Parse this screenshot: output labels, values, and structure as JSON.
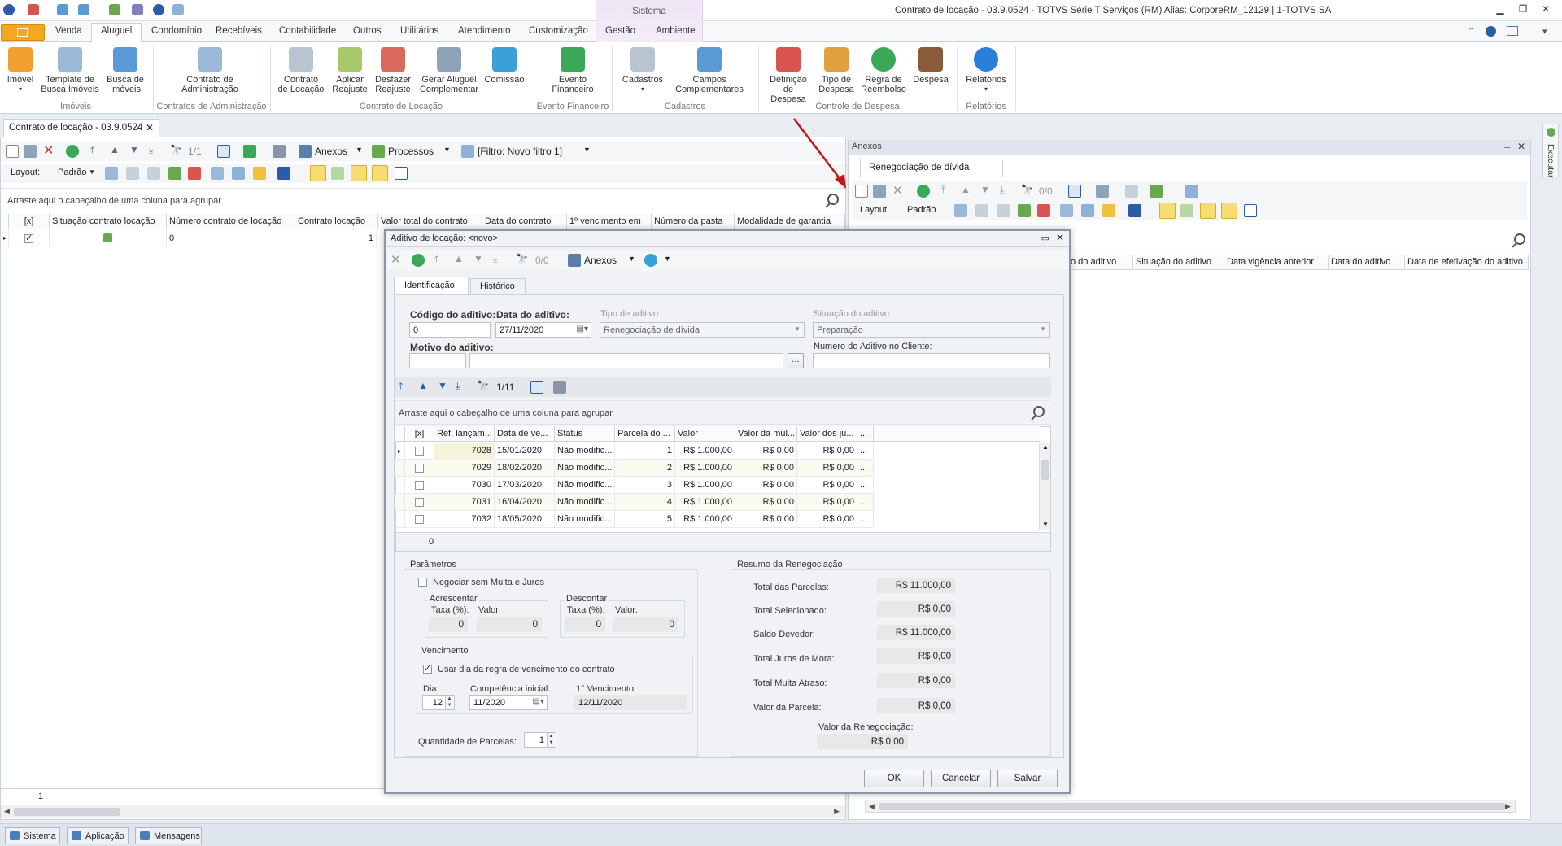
{
  "window": {
    "title": "Contrato de locação - 03.9.0524 - TOTVS Série T Serviços (RM) Alias: CorporeRM_12129 | 1-TOTVS SA",
    "context_tab": "Sistema"
  },
  "ribbon_tabs": [
    "Venda",
    "Aluguel",
    "Condomínio",
    "Recebíveis",
    "Contabilidade",
    "Outros",
    "Utilitários",
    "Atendimento",
    "Customização",
    "Gestão",
    "Ambiente"
  ],
  "ribbon": {
    "buttons": {
      "imovel": "Imóvel",
      "template1": "Template de",
      "template2": "Busca Imóveis",
      "busca1": "Busca de",
      "busca2": "Imóveis",
      "contrato_adm1": "Contrato de",
      "contrato_adm2": "Administração",
      "contrato_loc1": "Contrato",
      "contrato_loc2": "de Locação",
      "aplicar1": "Aplicar",
      "aplicar2": "Reajuste",
      "desfazer1": "Desfazer",
      "desfazer2": "Reajuste",
      "gerar1": "Gerar Aluguel",
      "gerar2": "Complementar",
      "comissao": "Comissão",
      "evento1": "Evento",
      "evento2": "Financeiro",
      "cadastros": "Cadastros",
      "campos1": "Campos",
      "campos2": "Complementares",
      "definicao1": "Definição",
      "definicao2": "de Despesa",
      "tipo1": "Tipo de",
      "tipo2": "Despesa",
      "regra1": "Regra de",
      "regra2": "Reembolso",
      "despesa": "Despesa",
      "relatorios": "Relatórios"
    },
    "groups": {
      "imoveis": "Imóveis",
      "contratos_adm": "Contratos de Administração",
      "contrato_loc": "Contrato de Locação",
      "evento_fin": "Evento Financeiro",
      "cadastros": "Cadastros",
      "controle": "Controle de Despesa",
      "relatorios": "Relatórios"
    }
  },
  "doc_tab": "Contrato de locação - 03.9.0524",
  "main": {
    "toolbar": {
      "record_count": "1/1",
      "anexos": "Anexos",
      "processos": "Processos",
      "filtro": "[Filtro: Novo filtro 1]",
      "layout_label": "Layout:",
      "layout_value": "Padrão"
    },
    "group_hint": "Arraste aqui o cabeçalho de uma coluna para agrupar",
    "columns": [
      "[x]",
      "Situação contrato locação",
      "Número contrato de locação",
      "Contrato locação",
      "Valor total do contrato",
      "Data do contrato",
      "1º vencimento em",
      "Número da pasta",
      "Modalidade de garantia"
    ],
    "row": {
      "numero": "0",
      "contrato": "1"
    },
    "footer_count": "1"
  },
  "anexos_panel": {
    "header": "Anexos",
    "tab": "Renegociação de dívida",
    "record_count": "0/0",
    "layout_label": "Layout:",
    "layout_value": "Padrão",
    "columns": [
      "o do aditivo",
      "Situação do aditivo",
      "Data vigência anterior",
      "Data do aditivo",
      "Data de efetivação do aditivo"
    ]
  },
  "executar": "Executar",
  "statusbar": {
    "sistema": "Sistema",
    "aplicacao": "Aplicação",
    "mensagens": "Mensagens"
  },
  "modal": {
    "title": "Aditivo de locação: <novo>",
    "record_count": "0/0",
    "anexos": "Anexos",
    "tabs": {
      "identificacao": "Identificação",
      "historico": "Histórico"
    },
    "fields": {
      "codigo_label": "Código do aditivo:",
      "codigo_value": "0",
      "data_label": "Data do aditivo:",
      "data_value": "27/11/2020",
      "tipo_label": "Tipo de aditivo:",
      "tipo_value": "Renegociação de dívida",
      "situacao_label": "Situação do aditivo:",
      "situacao_value": "Preparação",
      "motivo_label": "Motivo do aditivo:",
      "numero_cliente_label": "Numero do Aditivo no Cliente:",
      "ellipsis": "..."
    },
    "grid": {
      "record_count": "1/11",
      "group_hint": "Arraste aqui o cabeçalho de uma coluna para agrupar",
      "columns": [
        "[x]",
        "Ref. lançam...",
        "Data de ve...",
        "Status",
        "Parcela do ...",
        "Valor",
        "Valor da mul...",
        "Valor dos ju...",
        "..."
      ],
      "rows": [
        {
          "ref": "7028",
          "data": "15/01/2020",
          "status": "Não modific...",
          "parcela": "1",
          "valor": "R$ 1.000,00",
          "multa": "R$ 0,00",
          "juros": "R$ 0,00",
          "more": "..."
        },
        {
          "ref": "7029",
          "data": "18/02/2020",
          "status": "Não modific...",
          "parcela": "2",
          "valor": "R$ 1.000,00",
          "multa": "R$ 0,00",
          "juros": "R$ 0,00",
          "more": "..."
        },
        {
          "ref": "7030",
          "data": "17/03/2020",
          "status": "Não modific...",
          "parcela": "3",
          "valor": "R$ 1.000,00",
          "multa": "R$ 0,00",
          "juros": "R$ 0,00",
          "more": "..."
        },
        {
          "ref": "7031",
          "data": "16/04/2020",
          "status": "Não modific...",
          "parcela": "4",
          "valor": "R$ 1.000,00",
          "multa": "R$ 0,00",
          "juros": "R$ 0,00",
          "more": "..."
        },
        {
          "ref": "7032",
          "data": "18/05/2020",
          "status": "Não modific...",
          "parcela": "5",
          "valor": "R$ 1.000,00",
          "multa": "R$ 0,00",
          "juros": "R$ 0,00",
          "more": "..."
        }
      ],
      "footer_count": "0"
    },
    "parametros": {
      "legend": "Parâmetros",
      "negociar": "Negociar sem Multa e Juros",
      "acrescentar": "Acrescentar",
      "descontar": "Descontar",
      "taxa": "Taxa (%):",
      "valor": "Valor:",
      "acr_taxa": "0",
      "acr_valor": "0",
      "desc_taxa": "0",
      "desc_valor": "0",
      "vencimento_legend": "Vencimento",
      "usar_dia": "Usar dia da regra de vencimento do contrato",
      "dia_label": "Dia:",
      "dia_value": "12",
      "competencia_label": "Competência inicial:",
      "competencia_value": "11/2020",
      "primeiro_venc_label": "1° Vencimento:",
      "primeiro_venc_value": "12/11/2020",
      "qtd_label": "Quantidade de Parcelas:",
      "qtd_value": "1"
    },
    "resumo": {
      "legend": "Resumo da Renegociação",
      "total_parcelas_label": "Total das Parcelas:",
      "total_parcelas": "R$ 11.000,00",
      "total_sel_label": "Total Selecionado:",
      "total_sel": "R$ 0,00",
      "saldo_label": "Saldo Devedor:",
      "saldo": "R$ 11.000,00",
      "juros_label": "Total Juros de Mora:",
      "juros": "R$ 0,00",
      "multa_label": "Total Multa Atraso:",
      "multa": "R$ 0,00",
      "parcela_label": "Valor da Parcela:",
      "parcela": "R$ 0,00",
      "reneg_label": "Valor da Renegociação:",
      "reneg": "R$ 0,00"
    },
    "buttons": {
      "ok": "OK",
      "cancelar": "Cancelar",
      "salvar": "Salvar"
    }
  },
  "colors": {
    "accent_orange": "#f5a623",
    "arrow_red": "#c0191a",
    "highlight_yellow": "#f7dc6f"
  }
}
